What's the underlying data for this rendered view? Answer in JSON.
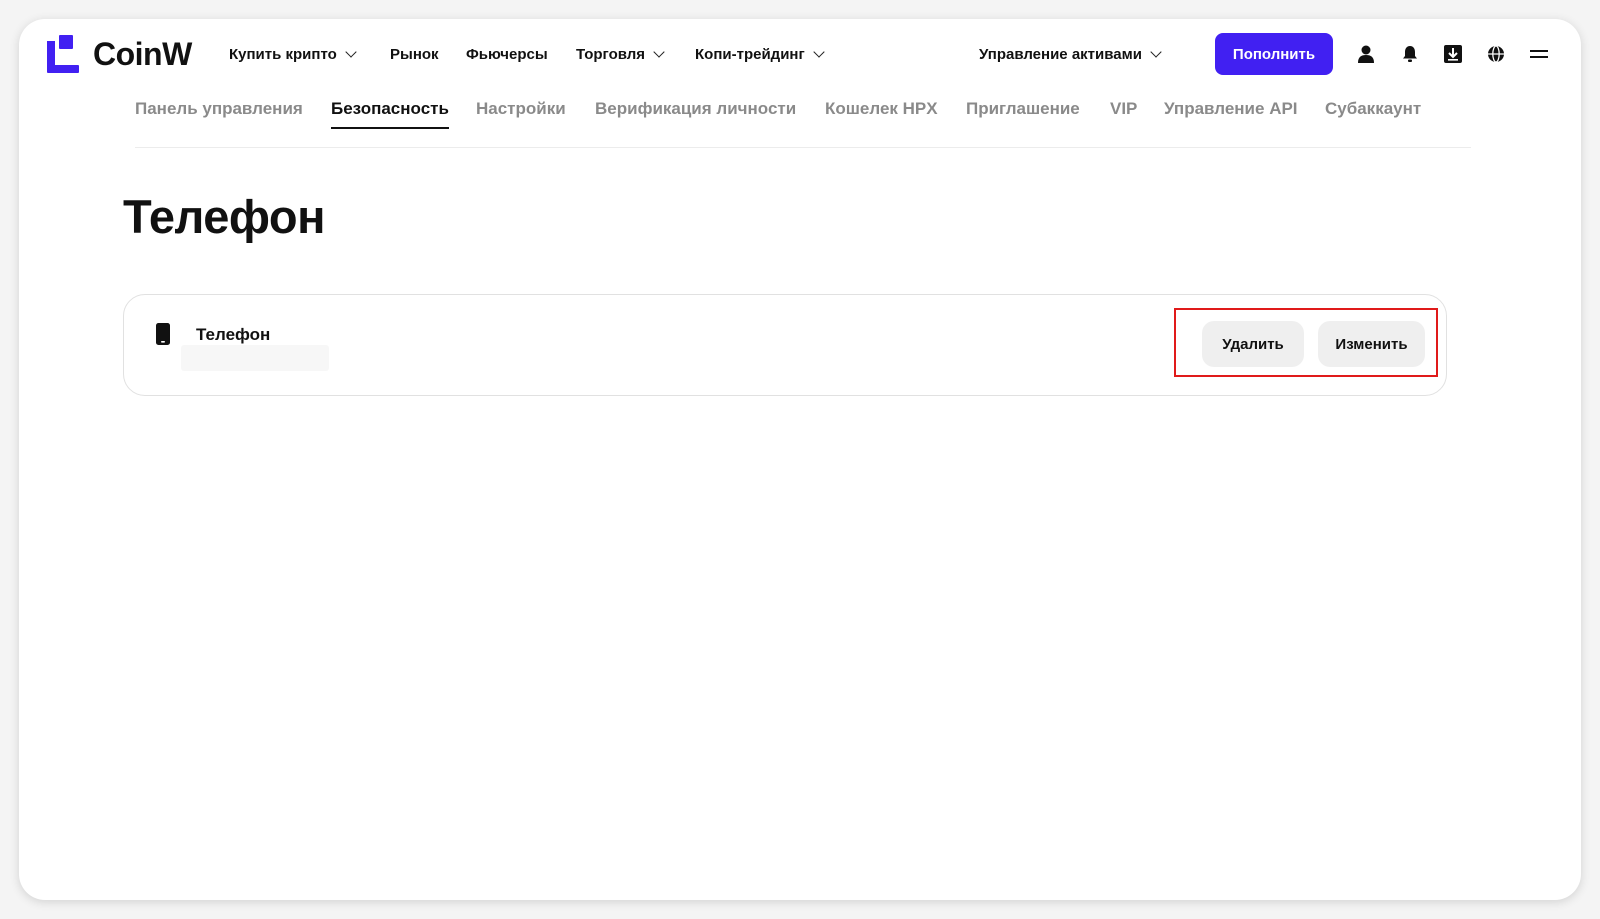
{
  "brand": {
    "name": "CoinW",
    "color": "#4120f2"
  },
  "topnav": {
    "items": [
      {
        "label": "Купить крипто",
        "has_dropdown": true
      },
      {
        "label": "Рынок",
        "has_dropdown": false
      },
      {
        "label": "Фьючерсы",
        "has_dropdown": false
      },
      {
        "label": "Торговля",
        "has_dropdown": true
      },
      {
        "label": "Копи-трейдинг",
        "has_dropdown": true
      }
    ],
    "asset_management": {
      "label": "Управление активами",
      "has_dropdown": true
    },
    "deposit_label": "Пополнить",
    "icons": [
      "user-icon",
      "bell-icon",
      "download-icon",
      "globe-icon",
      "menu-icon"
    ]
  },
  "subtabs": {
    "items": [
      {
        "label": "Панель управления",
        "active": false
      },
      {
        "label": "Безопасность",
        "active": true
      },
      {
        "label": "Настройки",
        "active": false
      },
      {
        "label": "Верификация личности",
        "active": false
      },
      {
        "label": "Кошелек HPX",
        "active": false
      },
      {
        "label": "Приглашение",
        "active": false
      },
      {
        "label": "VIP",
        "active": false
      },
      {
        "label": "Управление API",
        "active": false
      },
      {
        "label": "Субаккаунт",
        "active": false
      }
    ]
  },
  "page": {
    "title": "Телефон"
  },
  "phone_card": {
    "label": "Телефон",
    "icon": "phone-icon",
    "delete_label": "Удалить",
    "change_label": "Изменить",
    "highlight_color": "#e01a1a"
  }
}
